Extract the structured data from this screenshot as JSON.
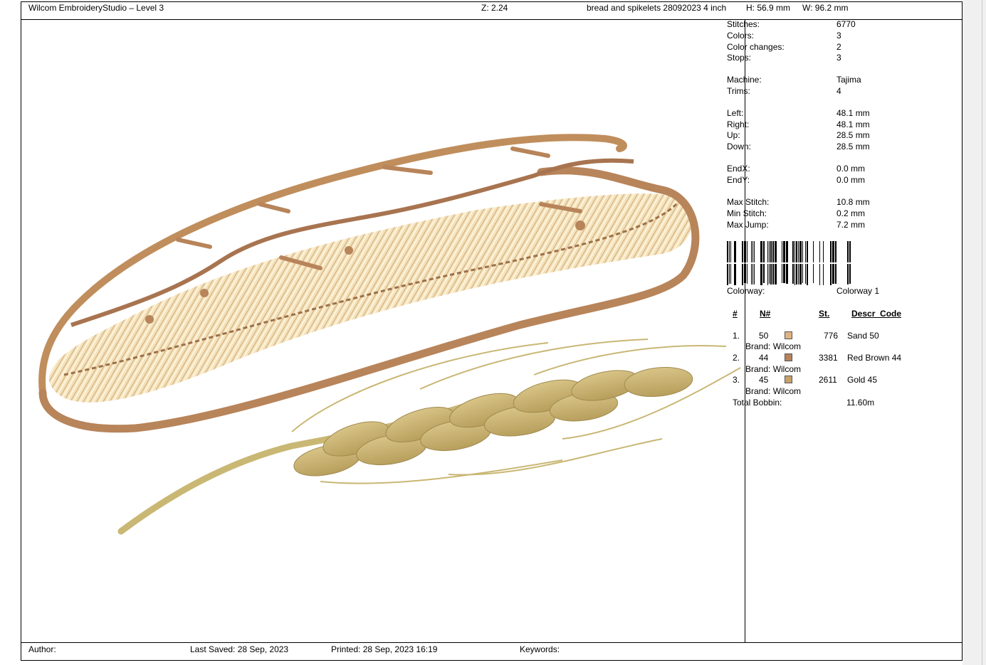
{
  "header": {
    "app_title": "Wilcom EmbroideryStudio – Level 3",
    "zoom": "Z: 2.24",
    "design_name": "bread and spikelets 28092023 4 inch",
    "height": "H: 56.9 mm",
    "width": "W: 96.2 mm"
  },
  "stats": [
    {
      "label": "Stitches:",
      "value": "6770"
    },
    {
      "label": "Colors:",
      "value": "3"
    },
    {
      "label": "Color changes:",
      "value": "2"
    },
    {
      "label": "Stops:",
      "value": "3"
    },
    {
      "label": "Machine:",
      "value": "Tajima"
    },
    {
      "label": "Trims:",
      "value": "4"
    },
    {
      "label": "Left:",
      "value": "48.1 mm"
    },
    {
      "label": "Right:",
      "value": "48.1 mm"
    },
    {
      "label": "Up:",
      "value": "28.5 mm"
    },
    {
      "label": "Down:",
      "value": "28.5 mm"
    },
    {
      "label": "EndX:",
      "value": "0.0 mm"
    },
    {
      "label": "EndY:",
      "value": "0.0 mm"
    },
    {
      "label": "Max Stitch:",
      "value": "10.8 mm"
    },
    {
      "label": "Min Stitch:",
      "value": "0.2 mm"
    },
    {
      "label": "Max Jump:",
      "value": "7.2 mm"
    }
  ],
  "colorway": {
    "label": "Colorway:",
    "value": "Colorway 1"
  },
  "color_table": {
    "headers": {
      "num": "#",
      "n_num": "N#",
      "stitches": "St.",
      "descr": "Descr_Code"
    },
    "rows": [
      {
        "index": "1.",
        "code": "50",
        "swatch": "#e2b27e",
        "stitches": "776",
        "name": "Sand 50",
        "brand": "Brand: Wilcom"
      },
      {
        "index": "2.",
        "code": "44",
        "swatch": "#b9825a",
        "stitches": "3381",
        "name": "Red Brown 44",
        "brand": "Brand: Wilcom"
      },
      {
        "index": "3.",
        "code": "45",
        "swatch": "#c8a06a",
        "stitches": "2611",
        "name": "Gold 45",
        "brand": "Brand: Wilcom"
      }
    ],
    "total_label": "Total Bobbin:",
    "total_value": "11.60m"
  },
  "footer": {
    "author": "Author:",
    "last_saved": "Last Saved: 28 Sep, 2023",
    "printed": "Printed: 28 Sep, 2023 16:19",
    "keywords": "Keywords:"
  }
}
